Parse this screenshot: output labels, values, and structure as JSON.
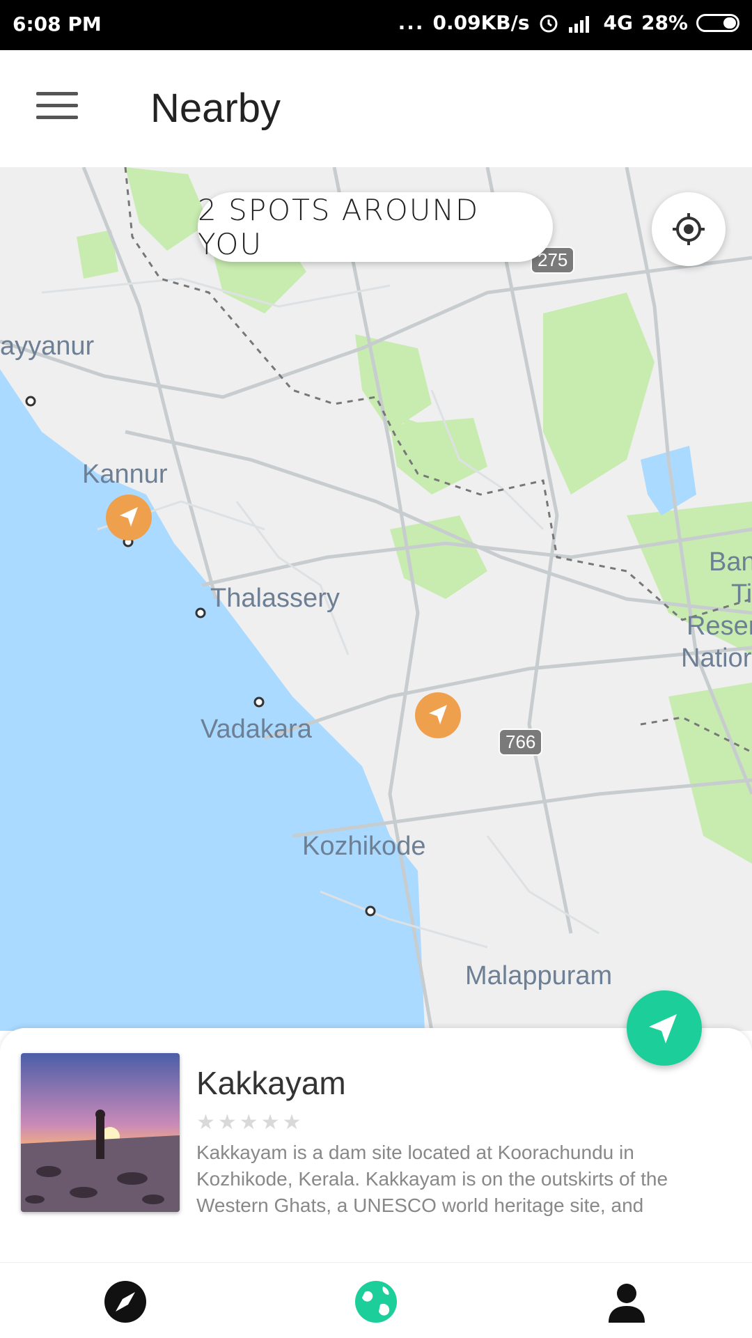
{
  "status_bar": {
    "time": "6:08 PM",
    "dots": "...",
    "speed": "0.09KB/s",
    "network": "4G",
    "battery": "28%"
  },
  "app_bar": {
    "title": "Nearby",
    "menu_icon": "hamburger-menu-icon"
  },
  "map": {
    "spots_label": "2 SPOTS AROUND YOU",
    "locate_icon": "my-location-icon",
    "labels": {
      "payyanur": "ayyanur",
      "kannur": "Kannur",
      "thalassery": "Thalassery",
      "vadakara": "Vadakara",
      "kozhikode": "Kozhikode",
      "malappuram": "Malappuram",
      "ban": "Ban",
      "ti": "Ti",
      "reser": "Reser",
      "natio": "Natior"
    },
    "shields": {
      "nh275": "275",
      "nh766": "766"
    },
    "marker_color": "#efa04d",
    "water_color": "#aadaff",
    "forest_color": "#c8ecb0"
  },
  "card": {
    "name": "Kakkayam",
    "stars": "★★★★★",
    "rating": 0,
    "description": "Kakkayam is a dam site located at Koorachundu in Kozhikode, Kerala. Kakkayam is on the outskirts of the Western Ghats, a UNESCO world heritage site, and",
    "navigate_icon": "navigation-arrow-icon",
    "accent": "#1ccf9a"
  },
  "bottom_nav": {
    "items": [
      {
        "icon": "compass-icon"
      },
      {
        "icon": "globe-icon",
        "active": true
      },
      {
        "icon": "person-icon"
      }
    ],
    "active_color": "#1ccf9a"
  }
}
